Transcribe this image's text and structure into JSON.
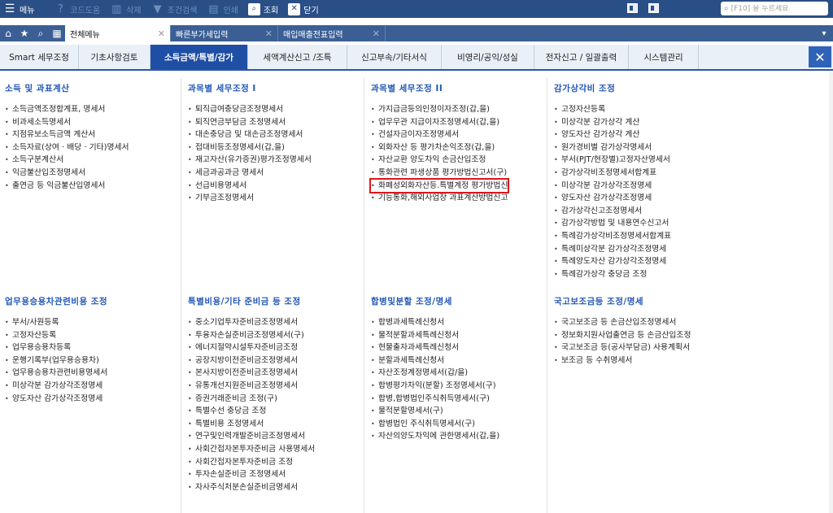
{
  "toolbar": {
    "menu": "메뉴",
    "code_help": "코드도움",
    "delete": "삭제",
    "filter": "조건검색",
    "print": "인쇄",
    "query": "조회",
    "close": "닫기",
    "search_placeholder": "[F10] 을 누르세요"
  },
  "tabs": [
    {
      "label": "전체메뉴",
      "active": true
    },
    {
      "label": "빠른부가세입력",
      "active": false
    },
    {
      "label": "매입매출전표입력",
      "active": false
    }
  ],
  "categories": [
    "Smart 세무조정",
    "기초사항검토",
    "소득금액/특별/감가",
    "세액계산신고 /조특",
    "신고부속/기타서식",
    "비영리/공익/성실",
    "전자신고 / 일괄출력",
    "시스템관리"
  ],
  "sections": [
    {
      "title": "소득 및 과표계산",
      "items": [
        "소득금액조정합계표, 명세서",
        "비과세소득명세서",
        "지점유보소득금액 계산서",
        "소득자료(상여 · 배당 · 기타)명세서",
        "소득구분계산서",
        "익금불산입조정명세서",
        "출연금 등 익금불산입명세서"
      ]
    },
    {
      "title": "과목별 세무조정 I",
      "items": [
        "퇴직급여충당금조정명세서",
        "퇴직연금부담금 조정명세서",
        "대손충당금 및 대손금조정명세서",
        "접대비등조정명세서(갑,을)",
        "재고자산(유가증권)평가조정명세서",
        "세금과공과금 명세서",
        "선급비용명세서",
        "기부금조정명세서"
      ]
    },
    {
      "title": "과목별 세무조정 II",
      "items": [
        "가지급금등의인정이자조정(갑,을)",
        "업무무관 지급이자조정명세서(갑,을)",
        "건설자금이자조정명세서",
        "외화자산 등 평가차손익조정(갑,을)",
        "자산교환 양도차익 손금산입조정",
        "통화관련 파생상품 평가방법신고서(구)",
        "화폐성외화자산등.특별계정 평가방법신",
        "기능통화,해외사업장 과표계산방법신고"
      ]
    },
    {
      "title": "감가상각비 조정",
      "items": [
        "고정자산등록",
        "미상각분 감가상각 계산",
        "양도자산 감가상각 계산",
        "원가경비별 감가상각명세서",
        "부서(PJT/현장별)고정자산명세서",
        "감가상각비조정명세서합계표",
        "미상각분 감가상각조정명세",
        "양도자산 감가상각조정명세",
        "감가상각신고조정명세서",
        "감가상각방법 및 내용연수신고서",
        "특례감가상각비조정명세서합계표",
        "특례미상각분 감가상각조정명세",
        "특례양도자산 감가상각조정명세",
        "특례감가상각 충당금 조정"
      ]
    },
    {
      "title": "업무용승용차관련비용 조정",
      "items": [
        "부서/사원등록",
        "고정자산등록",
        "업무용승용차등록",
        "운행기록부(업무용승용차)",
        "업무용승용차관련비용명세서",
        "미상각분 감가상각조정명세",
        "양도자산 감가상각조정명세"
      ]
    },
    {
      "title": "특별비용/기타 준비금 등 조정",
      "items": [
        "중소기업투자준비금조정명세서",
        "투융자손실준비금조정명세서(구)",
        "에너지절약시설투자준비금조정",
        "공장지방이전준비금조정명세서",
        "본사지방이전준비금조정명세서",
        "유통개선지원준비금조정명세서",
        "증권거래준비금 조정(구)",
        "특별수선 충당금 조정",
        "특별비용 조정명세서",
        "연구및인력개발준비금조정명세서",
        "사회간접자본투자준비금 사용명세서",
        "사회간접자본투자준비금 조정",
        "투자손실준비금 조정명세서",
        "자사주식처분손실준비금명세서"
      ]
    },
    {
      "title": "합병및분할 조정/명세",
      "items": [
        "합병과세특례신청서",
        "물적분할과세특례신청서",
        "현물출자과세특례신청서",
        "분할과세특례신청서",
        "자산조정계정명세서(갑/을)",
        "합병평가차익(분할) 조정명세서(구)",
        "합병,합병법인주식취득명세서(구)",
        "물적분할명세서(구)",
        "합병법인 주식취득명세서(구)",
        "자산의양도차익에 관한명세서(갑,을)"
      ]
    },
    {
      "title": "국고보조금등 조정/명세",
      "items": [
        "국고보조금 등 손금산입조정명세서",
        "정보화지원사업출연금 등 손금산입조정",
        "국고보조금 등(공사부담금) 사용계획서",
        "보조금 등 수취명세서"
      ]
    }
  ],
  "highlighted_item": "화폐성외화자산등.특별계정 평가방법신"
}
